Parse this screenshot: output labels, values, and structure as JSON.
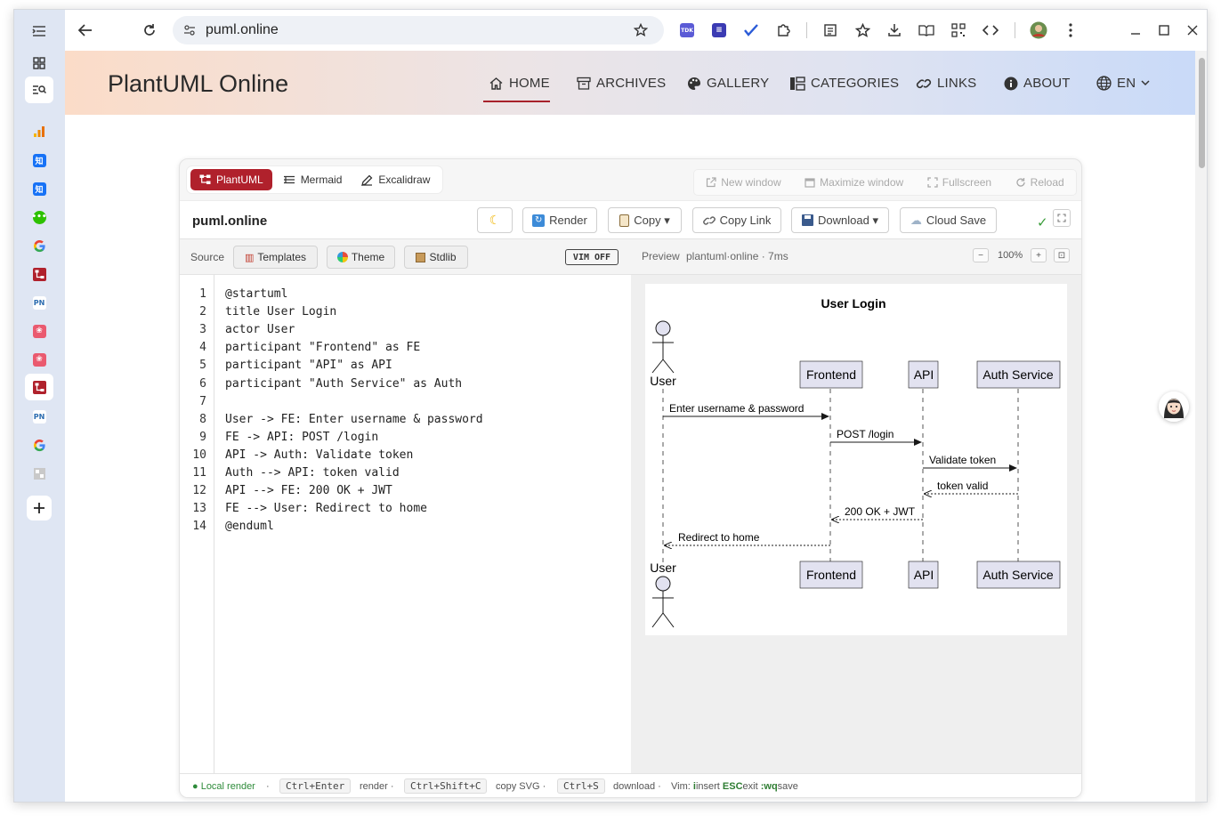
{
  "browser": {
    "url": "puml.online",
    "colors": {
      "tabbar": "#dfe6f3",
      "accent": "#b0212c"
    }
  },
  "site": {
    "brand": "PlantUML Online",
    "nav": [
      {
        "label": "HOME",
        "icon": "home-icon"
      },
      {
        "label": "ARCHIVES",
        "icon": "archive-icon"
      },
      {
        "label": "GALLERY",
        "icon": "palette-icon"
      },
      {
        "label": "CATEGORIES",
        "icon": "categories-icon"
      },
      {
        "label": "LINKS",
        "icon": "link-icon"
      },
      {
        "label": "ABOUT",
        "icon": "info-icon"
      },
      {
        "label": "EN",
        "icon": "globe-icon"
      }
    ]
  },
  "editor": {
    "mode_tabs": [
      "PlantUML",
      "Mermaid",
      "Excalidraw"
    ],
    "window_actions": [
      "New window",
      "Maximize window",
      "Fullscreen",
      "Reload"
    ],
    "doc_title": "puml.online",
    "actions": {
      "render": "Render",
      "copy": "Copy ▾",
      "copy_link": "Copy Link",
      "download": "Download ▾",
      "cloud_save": "Cloud Save",
      "status_check": "✓"
    },
    "source": {
      "label": "Source",
      "templates": "Templates",
      "theme": "Theme",
      "stdlib": "Stdlib",
      "vim": "VIM OFF"
    },
    "line_numbers": [
      "1",
      "2",
      "3",
      "4",
      "5",
      "6",
      "7",
      "8",
      "9",
      "10",
      "11",
      "12",
      "13",
      "14"
    ],
    "code_lines": [
      "@startuml",
      "title User Login",
      "actor User",
      "participant \"Frontend\" as FE",
      "participant \"API\" as API",
      "participant \"Auth Service\" as Auth",
      "",
      "User -> FE: Enter username & password",
      "FE -> API: POST /login",
      "API -> Auth: Validate token",
      "Auth --> API: token valid",
      "API --> FE: 200 OK + JWT",
      "FE --> User: Redirect to home",
      "@enduml"
    ],
    "preview": {
      "label": "Preview",
      "meta": "plantuml·online · 7ms",
      "zoom": "100%",
      "zoom_out": "−",
      "zoom_in": "+",
      "fit": "⊡"
    },
    "status": {
      "local_render": "● Local render",
      "sep": "·",
      "kbd_render": "Ctrl+Enter",
      "render_text": "render ·",
      "kbd_copy": "Ctrl+Shift+C",
      "copy_text": "copy SVG ·",
      "kbd_download": "Ctrl+S",
      "download_text": "download ·",
      "vim_prefix": "Vim:",
      "vim_i": "i",
      "vim_insert": "insert",
      "vim_esc": "ESC",
      "vim_exit": "exit",
      "vim_wq": ":wq",
      "vim_save": "save"
    }
  },
  "diagram": {
    "title": "User Login",
    "actor": "User",
    "participants": [
      "Frontend",
      "API",
      "Auth Service"
    ],
    "messages": [
      "Enter username & password",
      "POST /login",
      "Validate token",
      "token valid",
      "200 OK + JWT",
      "Redirect to home"
    ]
  }
}
